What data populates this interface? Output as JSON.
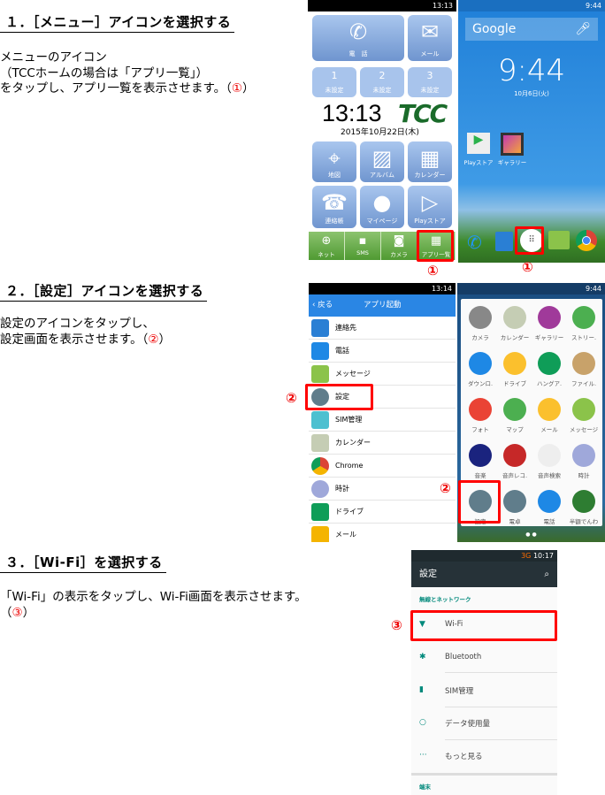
{
  "steps": [
    {
      "heading": "１．［メニュー］アイコンを選択する",
      "lines": [
        "メニューのアイコン",
        "（TCCホームの場合は「アプリ一覧」）",
        "をタップし、アプリ一覧を表示させます。（"
      ],
      "marker": "①",
      "close": "）"
    },
    {
      "heading": "２．［設定］アイコンを選択する",
      "lines": [
        "設定のアイコンをタップし、",
        "設定画面を表示させます。（"
      ],
      "marker": "②",
      "close": "）"
    },
    {
      "heading": "３．［Wi-Fi］を選択する",
      "lines": [
        "「Wi-Fi」の表示をタップし、Wi-Fi画面を表示させます。",
        "（"
      ],
      "marker": "③",
      "close": "）"
    }
  ],
  "tcc_home": {
    "status_time": "13:13",
    "tiles": {
      "phone": "電　話",
      "mail": "メール",
      "speed": [
        {
          "n": "1",
          "l": "未設定"
        },
        {
          "n": "2",
          "l": "未設定"
        },
        {
          "n": "3",
          "l": "未設定"
        }
      ],
      "map": "地図",
      "album": "アルバム",
      "calendar": "カレンダー",
      "contacts": "連絡帳",
      "mypage": "マイページ",
      "playstore": "Playストア"
    },
    "clock": "13:13",
    "logo": "TCC",
    "date": "2015年10月22日(木)",
    "bottom": [
      "ネット",
      "SMS",
      "カメラ",
      "アプリ一覧"
    ]
  },
  "android_home": {
    "status_time": "9:44",
    "search": "Google",
    "clock": "9:44",
    "date": "10月6日(火)",
    "apps": [
      "Playストア",
      "ギャラリー"
    ]
  },
  "app_launcher": {
    "status_time": "13:14",
    "back": "戻る",
    "title": "アプリ起動",
    "items": [
      "連絡先",
      "電話",
      "メッセージ",
      "設定",
      "SIM管理",
      "カレンダー",
      "Chrome",
      "時計",
      "ドライブ",
      "メール"
    ]
  },
  "app_drawer": {
    "status_time": "9:44",
    "apps": [
      "カメラ",
      "カレンダー",
      "ギャラリー",
      "ストリー.",
      "ダウンロ.",
      "ドライブ",
      "ハングア.",
      "ファイル.",
      "フォト",
      "マップ",
      "メール",
      "メッセージ",
      "音楽",
      "音声レコ.",
      "音声検索",
      "時計",
      "設定",
      "電卓",
      "電話",
      "半額でんわ"
    ]
  },
  "settings": {
    "status_time": "10:17",
    "network": "3G",
    "title": "設定",
    "section": "無線とネットワーク",
    "items": [
      "Wi-Fi",
      "Bluetooth",
      "SIM管理",
      "データ使用量",
      "もっと見る"
    ],
    "section2": "端末"
  },
  "colors": {
    "marker": "#ee0000",
    "highlight": "#ff0000",
    "teal": "#00897b"
  }
}
